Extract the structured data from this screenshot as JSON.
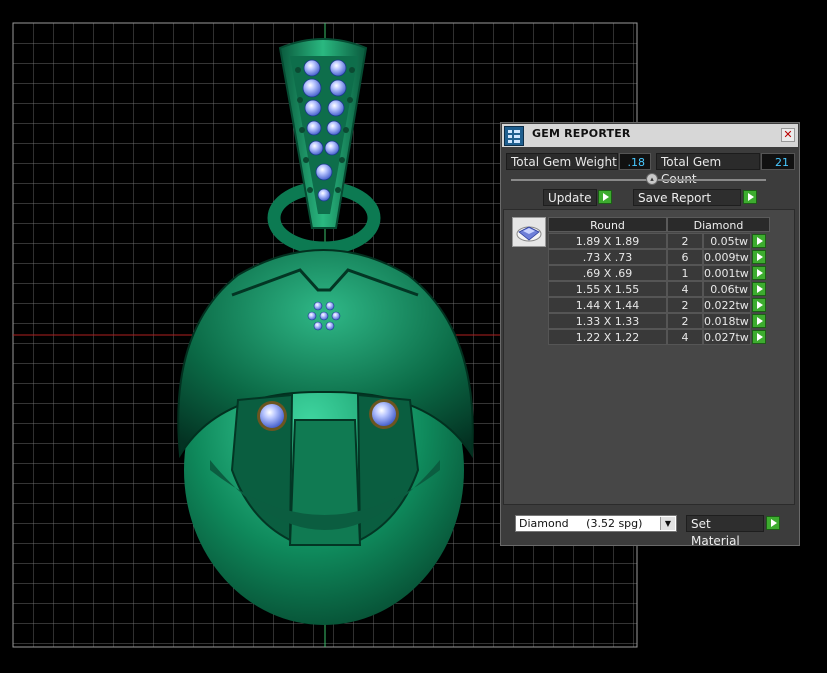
{
  "panel": {
    "title": "GEM REPORTER",
    "close_glyph": "✕",
    "icon": "gem-reporter-icon",
    "total_weight_label": "Total Gem Weight",
    "total_weight_value": ".18",
    "total_count_label": "Total Gem Count",
    "total_count_value": "21",
    "update_label": "Update",
    "save_report_label": "Save Report",
    "table": {
      "header_shape": "Round",
      "header_material": "Diamond",
      "rows": [
        {
          "size": "1.89 X 1.89",
          "count": "2",
          "weight": "0.05tw"
        },
        {
          "size": ".73 X .73",
          "count": "6",
          "weight": "0.009tw"
        },
        {
          "size": ".69 X .69",
          "count": "1",
          "weight": "0.001tw"
        },
        {
          "size": "1.55 X 1.55",
          "count": "4",
          "weight": "0.06tw"
        },
        {
          "size": "1.44 X 1.44",
          "count": "2",
          "weight": "0.022tw"
        },
        {
          "size": "1.33 X 1.33",
          "count": "2",
          "weight": "0.018tw"
        },
        {
          "size": "1.22 X 1.22",
          "count": "4",
          "weight": "0.027tw"
        }
      ]
    },
    "material_select": {
      "name": "Diamond",
      "spg": "(3.52 spg)"
    },
    "set_material_label": "Set Material"
  },
  "colors": {
    "accent_green": "#3dac2f",
    "value_cyan": "#48c8ff",
    "model_green": "#0f7a55",
    "gem_blue": "#5a7fe0"
  }
}
